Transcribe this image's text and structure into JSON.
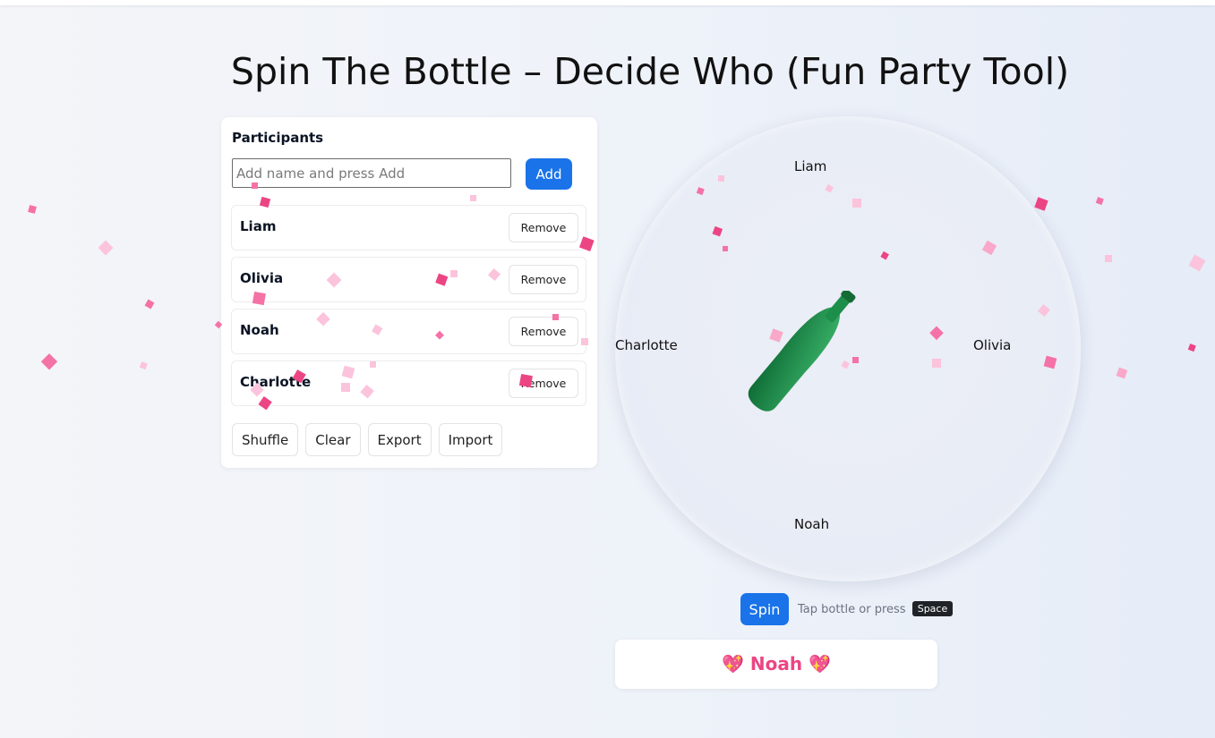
{
  "page": {
    "title": "Spin The Bottle – Decide Who (Fun Party Tool)"
  },
  "participants_panel": {
    "heading": "Participants",
    "input_placeholder": "Add name and press Add",
    "add_label": "Add",
    "remove_label": "Remove",
    "items": [
      {
        "name": "Liam"
      },
      {
        "name": "Olivia"
      },
      {
        "name": "Noah"
      },
      {
        "name": "Charlotte"
      }
    ],
    "actions": [
      "Shuffle",
      "Clear",
      "Export",
      "Import"
    ]
  },
  "wheel": {
    "labels": {
      "top": "Liam",
      "right": "Olivia",
      "bottom": "Noah",
      "left": "Charlotte"
    }
  },
  "controls": {
    "spin_label": "Spin",
    "hint_text": "Tap bottle or press",
    "hint_key": "Space"
  },
  "result": {
    "icon": "💖",
    "winner": "Noah"
  },
  "colors": {
    "accent": "#1a73e8",
    "winner_text": "#ec4584",
    "bottle_green": "#1e8f4a",
    "confetti_pink": "#f472a6",
    "confetti_light": "#fbc4dc"
  },
  "icons": {
    "bottle": "bottle-icon",
    "heart": "sparkling-heart-icon"
  }
}
